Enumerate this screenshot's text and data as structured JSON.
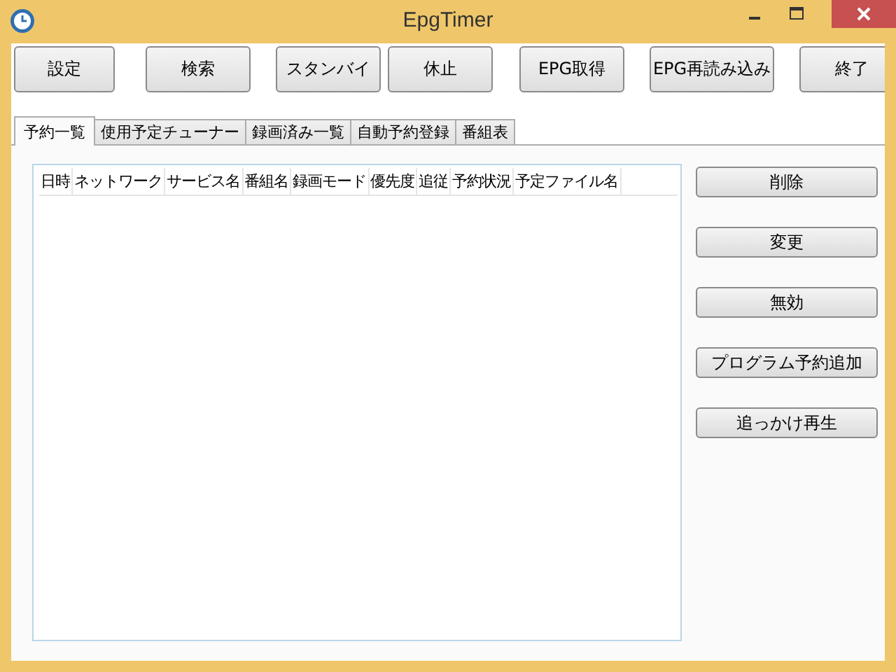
{
  "window": {
    "title": "EpgTimer"
  },
  "toolbar": [
    "設定",
    "検索",
    "スタンバイ",
    "休止",
    "EPG取得",
    "EPG再読み込み",
    "終了"
  ],
  "tabs": [
    {
      "label": "予約一覧",
      "selected": true
    },
    {
      "label": "使用予定チューナー",
      "selected": false
    },
    {
      "label": "録画済み一覧",
      "selected": false
    },
    {
      "label": "自動予約登録",
      "selected": false
    },
    {
      "label": "番組表",
      "selected": false
    }
  ],
  "table": {
    "columns": [
      "日時",
      "ネットワーク",
      "サービス名",
      "番組名",
      "録画モード",
      "優先度",
      "追従",
      "予約状況",
      "予定ファイル名"
    ]
  },
  "actions": [
    "削除",
    "変更",
    "無効",
    "プログラム予約追加",
    "追っかけ再生"
  ]
}
